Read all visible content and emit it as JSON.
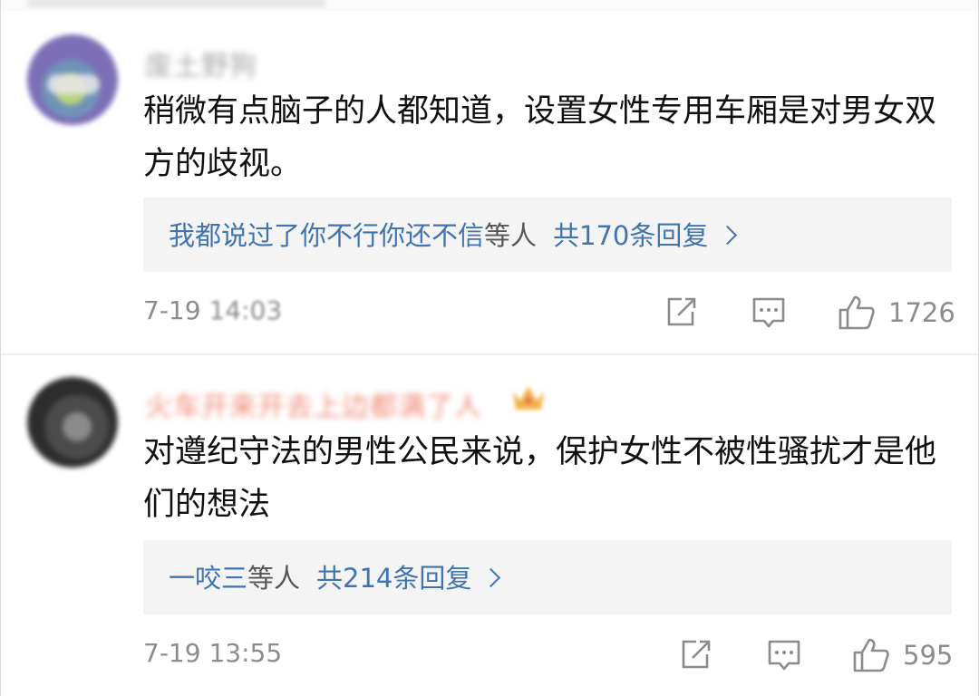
{
  "comments": [
    {
      "username": "废土野狗",
      "text": "稍微有点脑子的人都知道，设置女性专用车厢是对男女双方的歧视。",
      "reply_who": "我都说过了你不行你还不信",
      "reply_deng": "等人",
      "reply_count": "共170条回复",
      "time_a": "7-19 ",
      "time_b": "14:03",
      "likes": "1726"
    },
    {
      "username": "火车开来开去上边都满了人",
      "text": "对遵纪守法的男性公民来说，保护女性不被性骚扰才是他们的想法",
      "reply_who": "一咬三",
      "reply_deng": "等人",
      "reply_count": "共214条回复",
      "time_a": "7-19 13:55",
      "time_b": "",
      "likes": "595"
    }
  ],
  "icons": {
    "share": "share-icon",
    "comment": "comment-icon",
    "like": "thumbs-up-icon",
    "badge": "crown-badge-icon",
    "reply_chevron": "chevron-right-icon"
  },
  "colors": {
    "link": "#3f74b0",
    "meta": "#8c8c8c",
    "reply_bg": "#f4f4f4",
    "vip_name": "#ee8b76"
  }
}
